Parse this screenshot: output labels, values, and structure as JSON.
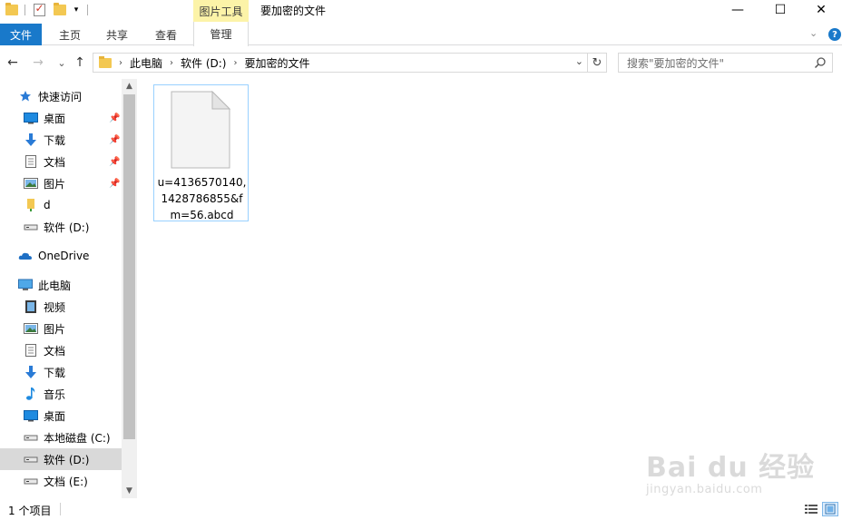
{
  "titlebar": {
    "context_tab_label": "图片工具",
    "window_title": "要加密的文件",
    "minimize": "—",
    "maximize": "☐",
    "close": "✕"
  },
  "ribbon": {
    "tabs": [
      {
        "label": "文件"
      },
      {
        "label": "主页"
      },
      {
        "label": "共享"
      },
      {
        "label": "查看"
      },
      {
        "label": "管理"
      }
    ],
    "expand_glyph": "⌄",
    "help_glyph": "?"
  },
  "address": {
    "back": "←",
    "forward": "→",
    "recent": "⌄",
    "up": "↑",
    "crumbs": [
      "此电脑",
      "软件 (D:)",
      "要加密的文件"
    ],
    "crumb_sep": "›",
    "dropdown": "⌄",
    "refresh": "↻",
    "search_placeholder": "搜索\"要加密的文件\""
  },
  "nav": {
    "items": [
      {
        "label": "快速访问",
        "icon": "star-icon"
      },
      {
        "label": "桌面",
        "icon": "desktop-icon",
        "pinned": true
      },
      {
        "label": "下载",
        "icon": "download-icon",
        "pinned": true
      },
      {
        "label": "文档",
        "icon": "document-icon",
        "pinned": true
      },
      {
        "label": "图片",
        "icon": "picture-icon",
        "pinned": true
      },
      {
        "label": "d",
        "icon": "folder-icon"
      },
      {
        "label": "软件 (D:)",
        "icon": "drive-icon"
      },
      {
        "label": "OneDrive",
        "icon": "cloud-icon"
      },
      {
        "label": "此电脑",
        "icon": "computer-icon"
      },
      {
        "label": "视频",
        "icon": "video-icon"
      },
      {
        "label": "图片",
        "icon": "picture-icon"
      },
      {
        "label": "文档",
        "icon": "document-icon"
      },
      {
        "label": "下载",
        "icon": "download-icon"
      },
      {
        "label": "音乐",
        "icon": "music-icon"
      },
      {
        "label": "桌面",
        "icon": "desktop-icon"
      },
      {
        "label": "本地磁盘 (C:)",
        "icon": "drive-icon"
      },
      {
        "label": "软件 (D:)",
        "icon": "drive-icon",
        "selected": true
      },
      {
        "label": "文档 (E:)",
        "icon": "drive-icon"
      }
    ],
    "pin_glyph": "📌"
  },
  "scroll": {
    "up": "▲",
    "down": "▼"
  },
  "files": [
    {
      "name": "u=4136570140,1428786855&fm=56.abcd",
      "icon": "blank-file-icon"
    }
  ],
  "status": {
    "item_count": "1 个项目"
  },
  "watermark": {
    "main": "Bai du 经验",
    "sub": "jingyan.baidu.com"
  },
  "colors": {
    "accent": "#1979ca",
    "context_tab": "#fcf3a8",
    "selection_border": "#99d1ff"
  }
}
